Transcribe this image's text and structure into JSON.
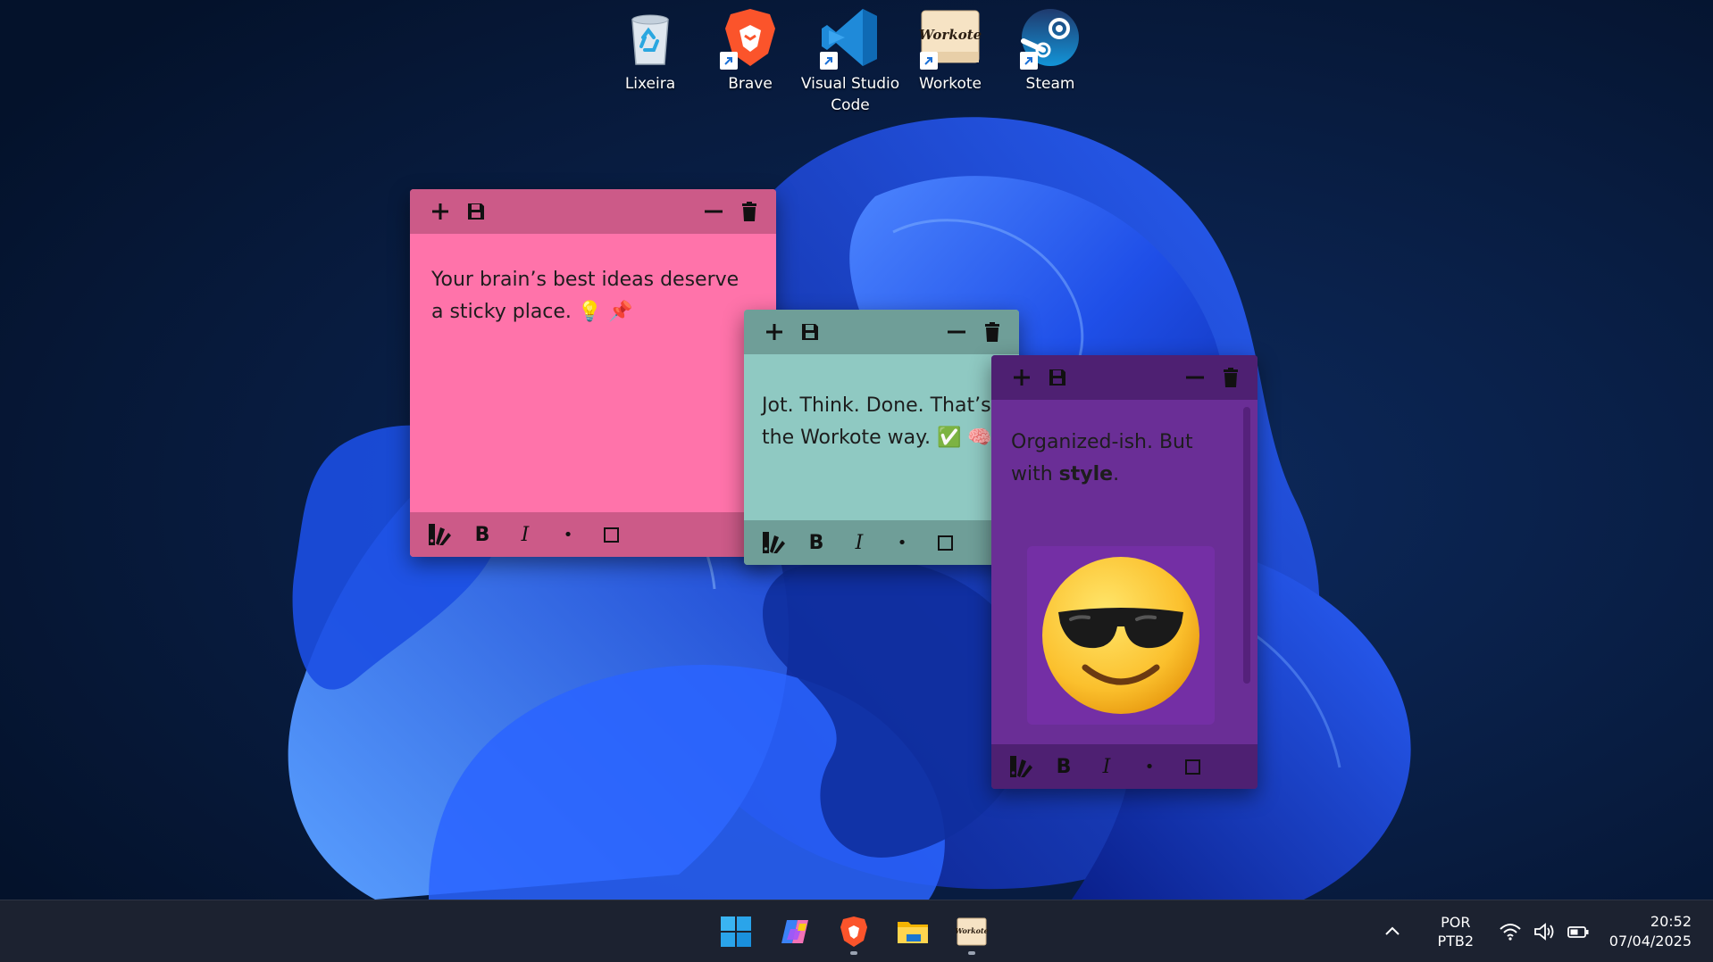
{
  "desktop": {
    "icons": [
      {
        "label": "Lixeira",
        "icon": "recycle-bin-icon"
      },
      {
        "label": "Brave",
        "icon": "brave-icon"
      },
      {
        "label": "Visual Studio Code",
        "icon": "vscode-icon"
      },
      {
        "label": "Workote",
        "icon": "workote-icon"
      },
      {
        "label": "Steam",
        "icon": "steam-icon"
      }
    ],
    "workote_logo_text": "Workote"
  },
  "notes": {
    "pink": {
      "color": "#ff73aa",
      "text": "Your brain’s best ideas deserve a sticky place. 💡 📌"
    },
    "teal": {
      "color": "#8fc9c2",
      "text": "Jot. Think. Done. That’s the Workote way. ✅ 🧠"
    },
    "purple": {
      "color": "#6a2e96",
      "text_before": "Organized-ish. But with ",
      "text_bold": "style",
      "text_after": ".",
      "image": "smiling-face-with-sunglasses-emoji"
    }
  },
  "toolbar": {
    "bold": "B",
    "italic": "I",
    "bullet": "•"
  },
  "taskbar": {
    "apps": [
      "start-icon",
      "copilot-icon",
      "brave-icon",
      "file-explorer-icon",
      "workote-icon"
    ],
    "language": "POR",
    "keyboard": "PTB2",
    "time": "20:52",
    "date": "07/04/2025"
  }
}
